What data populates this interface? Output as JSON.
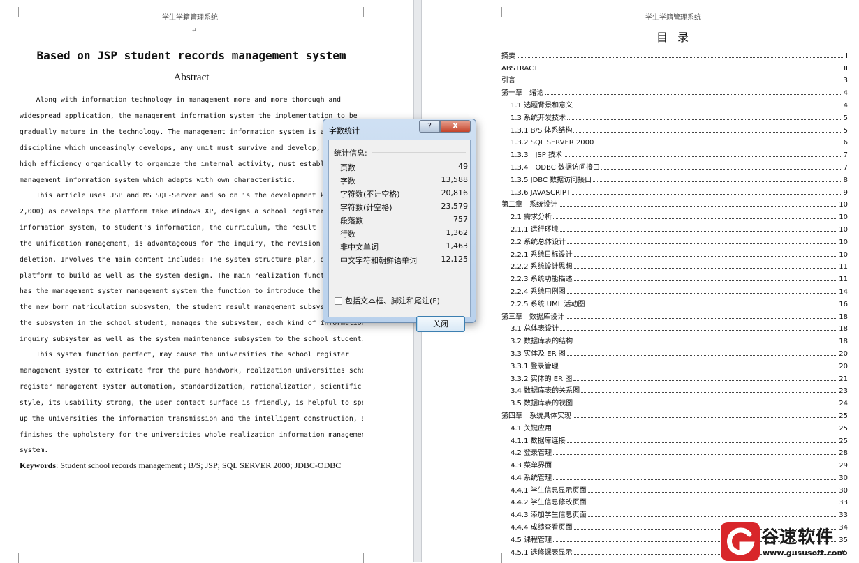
{
  "left_page": {
    "header": "学生学籍管理系统",
    "title": "Based on JSP student records management system",
    "abstract_heading": "Abstract",
    "paragraph_1_lines": [
      "    Along with information technology in management more and more thorough and",
      "widespread application, the management information system the implementation to be",
      "gradually mature in the technology. The management information system is a",
      "discipline which unceasingly develops, any unit must survive and develop, must",
      "high efficiency organically to organize the internal activity, must establish the",
      "management information system which adapts with own characteristic."
    ],
    "paragraph_2_lines": [
      "    This article uses JSP and MS SQL-Server and so on is the development kit, (",
      "2,000) as develops the platform take Windows XP, designs a school register",
      "information system, to student's information, the curriculum, the result",
      "the unification management, is advantageous for the inquiry, the revision",
      "deletion. Involves the main content includes: The system structure plan, d",
      "platform to build as well as the system design. The main realization funct",
      "has the management system management system the function to introduce the",
      "the new born matriculation subsystem, the student result management subsys",
      "the subsystem in the school student, manages the subsystem, each kind of information",
      "inquiry subsystem as well as the system maintenance subsystem to the school student."
    ],
    "paragraph_3_lines": [
      "    This system function perfect, may cause the universities the school register",
      "management system to extricate from the pure handwork, realization universities school",
      "register management system automation, standardization, rationalization, scientific",
      "style, its usability strong, the user contact surface is friendly, is helpful to speeds",
      "up the universities the information transmission and the intelligent construction, and",
      "finishes the upholstery for the universities whole realization information management",
      "system."
    ],
    "keywords_label": "Keywords",
    "keywords_text": ": Student school records management ; B/S; JSP; SQL SERVER 2000; JDBC-ODBC"
  },
  "right_page": {
    "header": "学生学籍管理系统",
    "toc_title": "目录",
    "toc": [
      {
        "label": "摘要",
        "page": "I",
        "level": 1
      },
      {
        "label": "ABSTRACT",
        "page": "II",
        "level": 1
      },
      {
        "label": "引言",
        "page": "3",
        "level": 1
      },
      {
        "label": "第一章　绪论",
        "page": "4",
        "level": 1
      },
      {
        "label": "1.1 选题背景和意义",
        "page": "4",
        "level": 2
      },
      {
        "label": "1.3 系统开发技术",
        "page": "5",
        "level": 2
      },
      {
        "label": "1.3.1 B/S 体系结构",
        "page": "5",
        "level": 2
      },
      {
        "label": "1.3.2 SQL SERVER 2000",
        "page": "6",
        "level": 2
      },
      {
        "label": "1.3.3　JSP 技术",
        "page": "7",
        "level": 2
      },
      {
        "label": "1.3.4　ODBC 数据访问接口",
        "page": "7",
        "level": 2
      },
      {
        "label": "1.3.5 JDBC 数据访问接口",
        "page": "8",
        "level": 2
      },
      {
        "label": "1.3.6 JAVASCRIPT",
        "page": "9",
        "level": 2
      },
      {
        "label": "第二章　系统设计",
        "page": "10",
        "level": 1
      },
      {
        "label": "2.1 需求分析",
        "page": "10",
        "level": 2
      },
      {
        "label": "2.1.1 运行环境",
        "page": "10",
        "level": 2
      },
      {
        "label": "2.2 系统总体设计",
        "page": "10",
        "level": 2
      },
      {
        "label": "2.2.1 系统目标设计",
        "page": "10",
        "level": 2
      },
      {
        "label": "2.2.2 系统设计思想",
        "page": "11",
        "level": 2
      },
      {
        "label": "2.2.3 系统功能描述",
        "page": "11",
        "level": 2
      },
      {
        "label": "2.2.4 系统用例图",
        "page": "14",
        "level": 2
      },
      {
        "label": "2.2.5 系统 UML 活动图",
        "page": "16",
        "level": 2
      },
      {
        "label": "第三章　数据库设计",
        "page": "18",
        "level": 1
      },
      {
        "label": "3.1 总体表设计",
        "page": "18",
        "level": 2
      },
      {
        "label": "3.2 数据库表的结构",
        "page": "18",
        "level": 2
      },
      {
        "label": "3.3 实体及 ER 图",
        "page": "20",
        "level": 2
      },
      {
        "label": "3.3.1 登录管理",
        "page": "20",
        "level": 2
      },
      {
        "label": "3.3.2 实体的 ER 图",
        "page": "21",
        "level": 2
      },
      {
        "label": "3.4 数据库表的关系图",
        "page": "23",
        "level": 2
      },
      {
        "label": "3.5 数据库表的视图",
        "page": "24",
        "level": 2
      },
      {
        "label": "第四章　系统具体实现",
        "page": "25",
        "level": 1
      },
      {
        "label": "4.1 关键应用",
        "page": "25",
        "level": 2
      },
      {
        "label": "4.1.1 数据库连接",
        "page": "25",
        "level": 2
      },
      {
        "label": "4.2 登录管理",
        "page": "28",
        "level": 2
      },
      {
        "label": "4.3 菜单界面",
        "page": "29",
        "level": 2
      },
      {
        "label": "4.4 系统管理",
        "page": "30",
        "level": 2
      },
      {
        "label": "4.4.1 学生信息显示页面",
        "page": "30",
        "level": 2
      },
      {
        "label": "4.4.2 学生信息修改页面",
        "page": "33",
        "level": 2
      },
      {
        "label": "4.4.3 添加学生信息页面",
        "page": "33",
        "level": 2
      },
      {
        "label": "4.4.4 成绩查看页面",
        "page": "34",
        "level": 2
      },
      {
        "label": "4.5 课程管理",
        "page": "35",
        "level": 2
      },
      {
        "label": "4.5.1 选修课表显示",
        "page": "35",
        "level": 2
      }
    ]
  },
  "dialog": {
    "title": "字数统计",
    "help_symbol": "?",
    "close_symbol": "X",
    "caption": "统计信息:",
    "stats": [
      {
        "label": "页数",
        "value": "49"
      },
      {
        "label": "字数",
        "value": "13,588"
      },
      {
        "label": "字符数(不计空格)",
        "value": "20,816"
      },
      {
        "label": "字符数(计空格)",
        "value": "23,579"
      },
      {
        "label": "段落数",
        "value": "757"
      },
      {
        "label": "行数",
        "value": "1,362"
      },
      {
        "label": "非中文单词",
        "value": "1,463"
      },
      {
        "label": "中文字符和朝鲜语单词",
        "value": "12,125"
      }
    ],
    "checkbox_label": "包括文本框、脚注和尾注(F)",
    "checkbox_checked": false,
    "close_button_label": "关闭"
  },
  "watermark": {
    "brand": "谷速软件",
    "url": "www.gususoft.com",
    "brand_color": "#d8262a"
  }
}
